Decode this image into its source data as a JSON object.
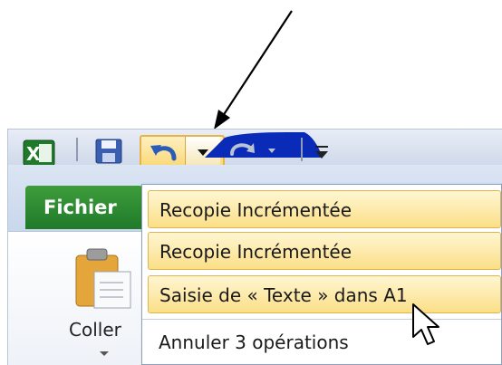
{
  "toolbar": {
    "icons": {
      "excel": "excel-app-icon",
      "save": "save-icon",
      "undo": "undo-icon",
      "undo_dropdown": "chevron-down-icon",
      "redo": "redo-icon",
      "customize": "customize-qat-icon"
    }
  },
  "ribbon": {
    "file_tab": "Fichier",
    "paste_label": "Coller"
  },
  "undo_menu": {
    "items": [
      "Recopie Incrémentée",
      "Recopie Incrémentée",
      "Saisie de « Texte » dans A1"
    ],
    "summary": "Annuler 3 opérations"
  },
  "colors": {
    "highlight": "#fbdf87",
    "file_tab": "#2a8a33",
    "annotation": "#0a2bb8"
  }
}
